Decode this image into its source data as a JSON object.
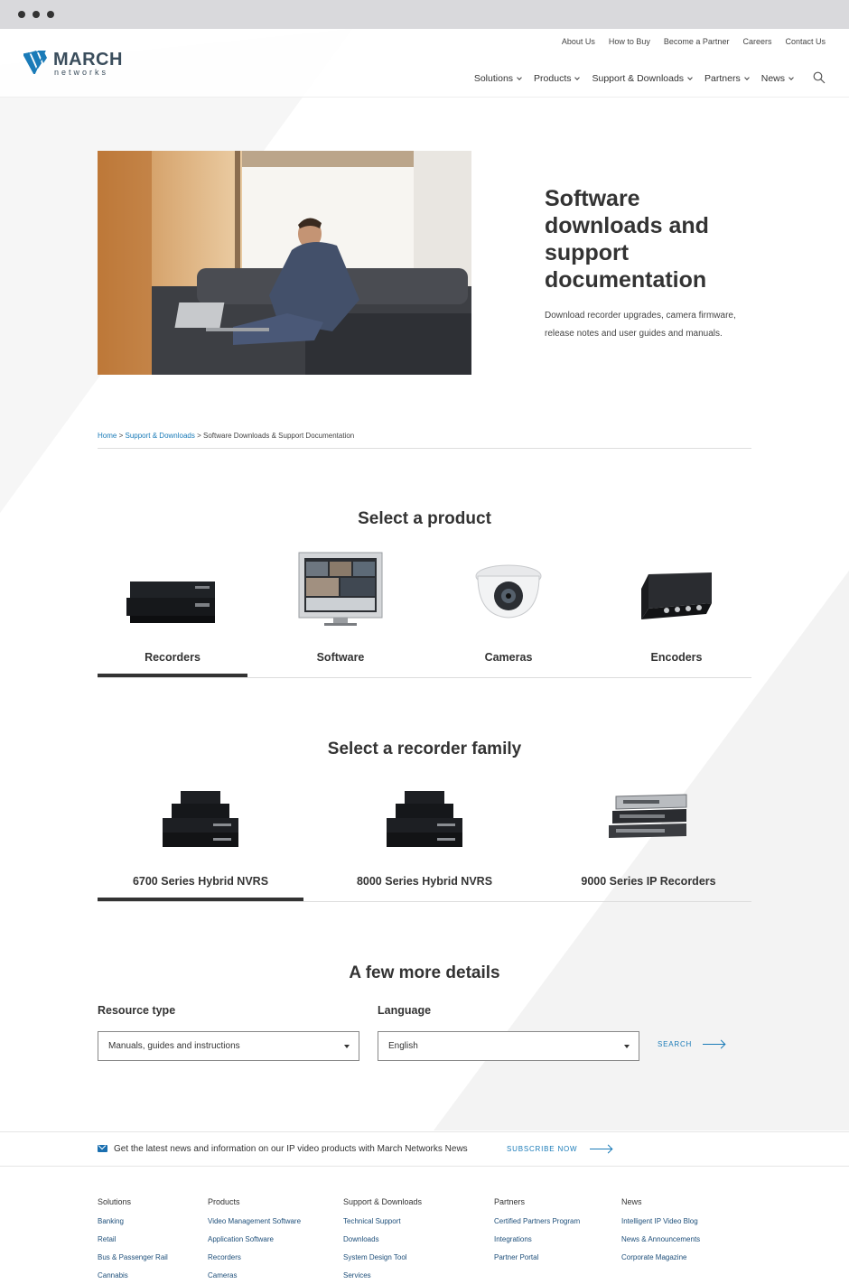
{
  "brand": {
    "name": "MARCH",
    "sub": "networks",
    "accent": "#1a7bb8"
  },
  "utility_nav": [
    "About Us",
    "How to Buy",
    "Become a Partner",
    "Careers",
    "Contact Us"
  ],
  "main_nav": [
    "Solutions",
    "Products",
    "Support & Downloads",
    "Partners",
    "News"
  ],
  "hero": {
    "title": "Software downloads and support documentation",
    "description": "Download recorder upgrades, camera firmware, release notes and user guides and manuals."
  },
  "breadcrumb": {
    "home": "Home",
    "sep1": ">",
    "support": "Support & Downloads",
    "sep2": ">",
    "current": "Software Downloads & Support Documentation"
  },
  "product_section": {
    "title": "Select a product",
    "items": [
      "Recorders",
      "Software",
      "Cameras",
      "Encoders"
    ],
    "active": "Recorders"
  },
  "family_section": {
    "title": "Select a recorder family",
    "items": [
      "6700 Series Hybrid NVRS",
      "8000 Series Hybrid NVRS",
      "9000 Series IP Recorders"
    ],
    "active": "6700 Series Hybrid NVRS"
  },
  "details": {
    "title": "A few more details",
    "resource_label": "Resource type",
    "resource_value": "Manuals, guides and instructions",
    "language_label": "Language",
    "language_value": "English",
    "search_label": "SEARCH"
  },
  "newsletter": {
    "message": "Get the latest news and information on our IP video products with March Networks News",
    "cta": "SUBSCRIBE NOW"
  },
  "footer": {
    "columns": [
      {
        "heading": "Solutions",
        "links": [
          "Banking",
          "Retail",
          "Bus & Passenger Rail",
          "Cannabis"
        ]
      },
      {
        "heading": "Products",
        "links": [
          "Video Management Software",
          "Application Software",
          "Recorders",
          "Cameras"
        ]
      },
      {
        "heading": "Support & Downloads",
        "links": [
          "Technical Support",
          "Downloads",
          "System Design Tool",
          "Services"
        ]
      },
      {
        "heading": "Partners",
        "links": [
          "Certified Partners Program",
          "Integrations",
          "Partner Portal"
        ]
      },
      {
        "heading": "News",
        "links": [
          "Intelligent IP Video Blog",
          "News & Announcements",
          "Corporate Magazine"
        ]
      }
    ]
  }
}
